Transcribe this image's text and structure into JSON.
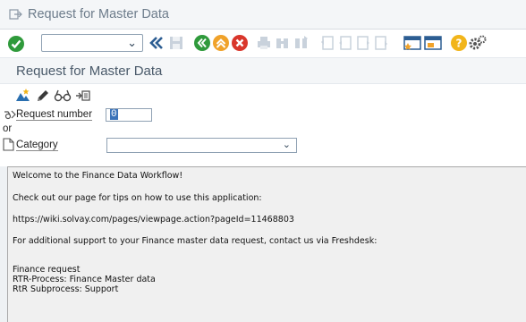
{
  "window": {
    "title": "Request for Master Data"
  },
  "toolbar": {
    "command_field_value": "",
    "icons": [
      "enter-icon",
      "command-field-dropdown",
      "back-icon",
      "save-icon",
      "back-green-icon",
      "exit-icon",
      "cancel-icon",
      "print-icon",
      "find-icon",
      "find-next-icon",
      "first-page-icon",
      "previous-page-icon",
      "next-page-icon",
      "last-page-icon",
      "new-session-icon",
      "shortcut-icon",
      "help-icon",
      "customize-icon"
    ]
  },
  "screen": {
    "title": "Request for Master Data"
  },
  "app_toolbar": {
    "icons": [
      "create-icon",
      "change-icon",
      "display-icon",
      "other-request-icon"
    ]
  },
  "form": {
    "request_number_label": "Request number",
    "request_number_value": "0",
    "or_label": "or",
    "category_label": "Category",
    "category_value": ""
  },
  "info": {
    "lines": [
      "Welcome to the Finance Data Workflow!",
      "Check out our page for tips on how to use this application:",
      "https://wiki.solvay.com/pages/viewpage.action?pageId=11468803",
      "For additional support to your Finance master data request, contact us via Freshdesk:",
      "Finance request",
      "RTR-Process: Finance Master data",
      "RtR Subprocess: Support"
    ]
  },
  "colors": {
    "ok_green": "#2f9a3b",
    "exit_orange": "#f0a22a",
    "cancel_red": "#d9362b",
    "help_yellow": "#f2b51a"
  }
}
